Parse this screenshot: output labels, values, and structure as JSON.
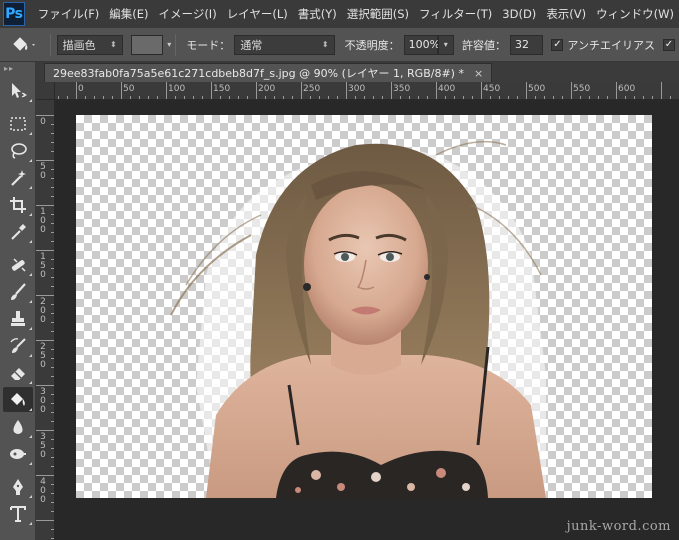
{
  "app": {
    "logo": "Ps"
  },
  "menu": [
    "ファイル(F)",
    "編集(E)",
    "イメージ(I)",
    "レイヤー(L)",
    "書式(Y)",
    "選択範囲(S)",
    "フィルター(T)",
    "3D(D)",
    "表示(V)",
    "ウィンドウ(W)"
  ],
  "options": {
    "tool_icon": "paint-bucket-icon",
    "fill_source": "描画色",
    "mode_label": "モード：",
    "mode_value": "通常",
    "opacity_label": "不透明度：",
    "opacity_value": "100%",
    "tolerance_label": "許容値：",
    "tolerance_value": "32",
    "antialias_label": "アンチエイリアス",
    "antialias_checked": true
  },
  "document": {
    "tab_title": "29ee83fab0fa75a5e61c271cdbeb8d7f_s.jpg @ 90% (レイヤー 1, RGB/8#) *",
    "close_glyph": "×",
    "zoom": "90%"
  },
  "ruler": {
    "h_labels": [
      "0",
      "50",
      "100",
      "150",
      "200",
      "250",
      "300",
      "350",
      "400",
      "450",
      "500",
      "550",
      "600"
    ],
    "v_labels": [
      "0",
      "5\n0",
      "1\n0\n0",
      "1\n5\n0",
      "2\n0\n0",
      "2\n5\n0",
      "3\n0\n0",
      "3\n5\n0",
      "4\n0\n0"
    ]
  },
  "tools": [
    {
      "name": "move-tool-icon",
      "active": false
    },
    {
      "name": "marquee-tool-icon",
      "active": false
    },
    {
      "name": "lasso-tool-icon",
      "active": false
    },
    {
      "name": "magic-wand-tool-icon",
      "active": false
    },
    {
      "name": "crop-tool-icon",
      "active": false
    },
    {
      "name": "eyedropper-tool-icon",
      "active": false
    },
    {
      "name": "healing-brush-tool-icon",
      "active": false
    },
    {
      "name": "brush-tool-icon",
      "active": false
    },
    {
      "name": "clone-stamp-tool-icon",
      "active": false
    },
    {
      "name": "history-brush-tool-icon",
      "active": false
    },
    {
      "name": "eraser-tool-icon",
      "active": false
    },
    {
      "name": "paint-bucket-tool-icon",
      "active": true
    },
    {
      "name": "blur-tool-icon",
      "active": false
    },
    {
      "name": "dodge-tool-icon",
      "active": false
    },
    {
      "name": "pen-tool-icon",
      "active": false
    },
    {
      "name": "type-tool-icon",
      "active": false
    }
  ],
  "watermark": "junk-word.com",
  "colors": {
    "menubar": "#3a3a3a",
    "panel": "#535353",
    "canvas_bg": "#282828",
    "checker_light": "#ffffff",
    "checker_dark": "#cccccc",
    "ps_blue": "#31a8ff"
  }
}
